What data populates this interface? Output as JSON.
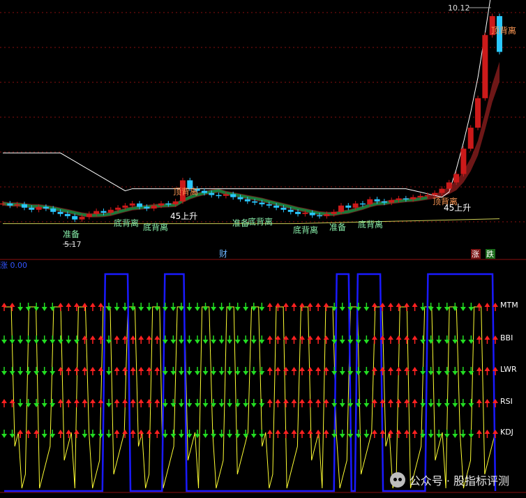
{
  "chart_data": [
    {
      "type": "candlestick",
      "price_high_label": "10.12",
      "price_low_label": "5.17",
      "ylim": [
        4.8,
        10.3
      ],
      "bars_count": 70,
      "closes": [
        5.6,
        5.55,
        5.58,
        5.5,
        5.45,
        5.52,
        5.48,
        5.4,
        5.35,
        5.3,
        5.22,
        5.28,
        5.35,
        5.42,
        5.38,
        5.45,
        5.5,
        5.55,
        5.6,
        5.52,
        5.48,
        5.55,
        5.6,
        5.58,
        5.65,
        6.15,
        5.95,
        5.9,
        5.85,
        5.8,
        5.78,
        5.82,
        5.75,
        5.7,
        5.65,
        5.62,
        5.58,
        5.55,
        5.5,
        5.45,
        5.4,
        5.35,
        5.38,
        5.32,
        5.3,
        5.35,
        5.4,
        5.55,
        5.5,
        5.6,
        5.58,
        5.7,
        5.65,
        5.62,
        5.68,
        5.72,
        5.7,
        5.75,
        5.78,
        5.8,
        5.85,
        5.95,
        6.1,
        6.3,
        6.9,
        7.4,
        8.1,
        9.6,
        10.05,
        9.2
      ],
      "annotations": [
        "顶背离",
        "45上升",
        "准备",
        "底背离",
        "底背离",
        "准备",
        "底背离",
        "底背离",
        "准备",
        "底背离",
        "顶背离",
        "45上升",
        "顶背离"
      ],
      "footer_labels": [
        "财",
        "涨",
        "跌"
      ]
    },
    {
      "type": "line",
      "title": "涨 0.00",
      "row_labels": [
        "MTM",
        "BBI",
        "LWR",
        "RSI",
        "KDJ"
      ],
      "arrow_up_color": "#ff2020",
      "arrow_down_color": "#22dd22",
      "blue_line_color": "#1a1aff",
      "yellow_line_color": "#ffff33"
    }
  ],
  "watermark": "公众号 · 股指标评测"
}
